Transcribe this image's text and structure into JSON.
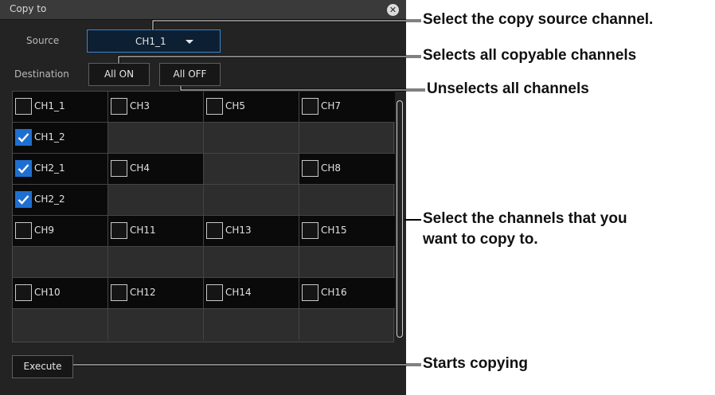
{
  "dialog": {
    "title": "Copy to",
    "source_label": "Source",
    "source_value": "CH1_1",
    "destination_label": "Destination",
    "all_on_label": "All ON",
    "all_off_label": "All OFF",
    "execute_label": "Execute"
  },
  "channels": {
    "ch1_1": {
      "label": "CH1_1",
      "checked": false
    },
    "ch3": {
      "label": "CH3",
      "checked": false
    },
    "ch5": {
      "label": "CH5",
      "checked": false
    },
    "ch7": {
      "label": "CH7",
      "checked": false
    },
    "ch1_2": {
      "label": "CH1_2",
      "checked": true
    },
    "ch2_1": {
      "label": "CH2_1",
      "checked": true
    },
    "ch4": {
      "label": "CH4",
      "checked": false
    },
    "ch8": {
      "label": "CH8",
      "checked": false
    },
    "ch2_2": {
      "label": "CH2_2",
      "checked": true
    },
    "ch9": {
      "label": "CH9",
      "checked": false
    },
    "ch11": {
      "label": "CH11",
      "checked": false
    },
    "ch13": {
      "label": "CH13",
      "checked": false
    },
    "ch15": {
      "label": "CH15",
      "checked": false
    },
    "ch10": {
      "label": "CH10",
      "checked": false
    },
    "ch12": {
      "label": "CH12",
      "checked": false
    },
    "ch14": {
      "label": "CH14",
      "checked": false
    },
    "ch16": {
      "label": "CH16",
      "checked": false
    }
  },
  "callouts": {
    "source": "Select the copy source channel.",
    "all_on": "Selects all copyable channels",
    "all_off": "Unselects all channels",
    "channels_line1": "Select the channels that you",
    "channels_line2": "want to copy to.",
    "execute": "Starts copying"
  }
}
